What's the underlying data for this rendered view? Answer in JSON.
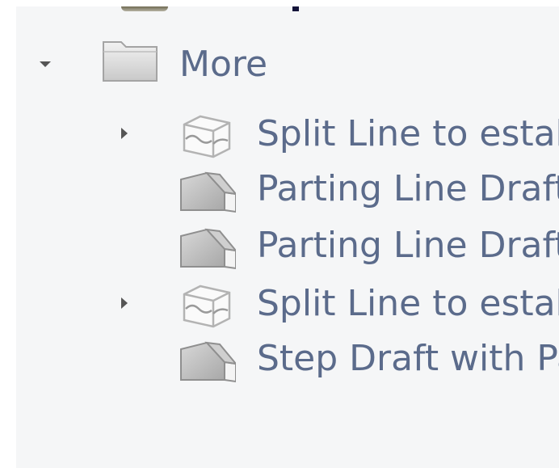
{
  "tree": {
    "folder": {
      "label": "More",
      "expanded": true,
      "icon": "folder-icon"
    },
    "items": [
      {
        "label": "Split Line to estab",
        "icon": "split-line-icon",
        "has_children": true
      },
      {
        "label": "Parting Line Draft",
        "icon": "draft-feature-icon",
        "has_children": false
      },
      {
        "label": "Parting Line Draft",
        "icon": "draft-feature-icon",
        "has_children": false
      },
      {
        "label": "Split Line to estab",
        "icon": "split-line-icon",
        "has_children": true
      },
      {
        "label": "Step Draft with Pa",
        "icon": "draft-feature-icon",
        "has_children": false
      }
    ]
  },
  "colors": {
    "background": "#f5f6f7",
    "text": "#5b6b8b",
    "arrow": "#555555"
  }
}
